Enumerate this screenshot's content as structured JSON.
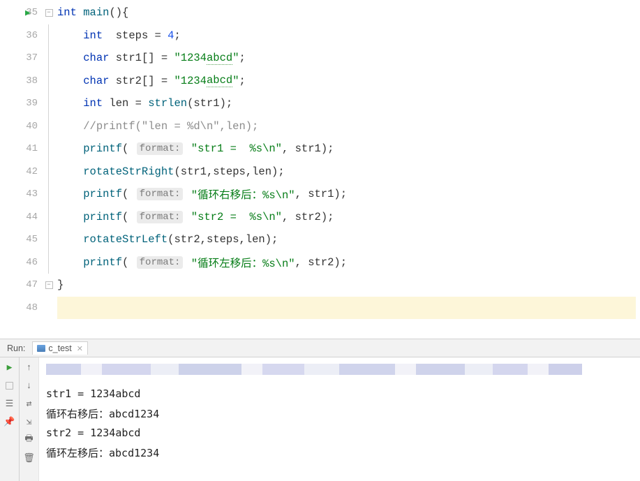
{
  "gutter": {
    "lines": [
      "35",
      "36",
      "37",
      "38",
      "39",
      "40",
      "41",
      "42",
      "43",
      "44",
      "45",
      "46",
      "47",
      "48"
    ]
  },
  "code": {
    "l35": {
      "kw1": "int ",
      "fn": "main",
      "paren": "(){"
    },
    "l36": {
      "indent": "    ",
      "kw": "int  ",
      "var": "steps",
      "eq": " = ",
      "num": "4",
      "semi": ";"
    },
    "l37": {
      "indent": "    ",
      "kw": "char ",
      "var": "str1",
      "br": "[] = ",
      "str1": "\"1234",
      "str2": "abcd",
      "str3": "\"",
      "semi": ";"
    },
    "l38": {
      "indent": "    ",
      "kw": "char ",
      "var": "str2",
      "br": "[] = ",
      "str1": "\"1234",
      "str2": "abcd",
      "str3": "\"",
      "semi": ";"
    },
    "l39": {
      "indent": "    ",
      "kw": "int ",
      "var": "len",
      "eq": " = ",
      "fn": "strlen",
      "p1": "(",
      "arg": "str1",
      "p2": ");"
    },
    "l40": {
      "indent": "    ",
      "cm": "//printf(\"len = %d\\n\",len);"
    },
    "l41": {
      "indent": "    ",
      "fn": "printf",
      "p1": "( ",
      "hint": "format:",
      "sp": " ",
      "str": "\"str1 =  %s\\n\"",
      "comma": ", ",
      "arg": "str1",
      "p2": ");"
    },
    "l42": {
      "indent": "    ",
      "fn": "rotateStrRight",
      "p1": "(",
      "a1": "str1",
      "c1": ",",
      "a2": "steps",
      "c2": ",",
      "a3": "len",
      "p2": ");"
    },
    "l43": {
      "indent": "    ",
      "fn": "printf",
      "p1": "( ",
      "hint": "format:",
      "sp": " ",
      "str": "\"循环右移后：%s\\n\"",
      "comma": ", ",
      "arg": "str1",
      "p2": ");"
    },
    "l44": {
      "indent": "    ",
      "fn": "printf",
      "p1": "( ",
      "hint": "format:",
      "sp": " ",
      "str": "\"str2 =  %s\\n\"",
      "comma": ", ",
      "arg": "str2",
      "p2": ");"
    },
    "l45": {
      "indent": "    ",
      "fn": "rotateStrLeft",
      "p1": "(",
      "a1": "str2",
      "c1": ",",
      "a2": "steps",
      "c2": ",",
      "a3": "len",
      "p2": ");"
    },
    "l46": {
      "indent": "    ",
      "fn": "printf",
      "p1": "( ",
      "hint": "format:",
      "sp": " ",
      "str": "\"循环左移后：%s\\n\"",
      "comma": ", ",
      "arg": "str2",
      "p2": ");"
    },
    "l47": {
      "close": "}"
    }
  },
  "run": {
    "label": "Run:",
    "tab": "c_test",
    "out1": "str1 =  1234abcd",
    "out2": "循环右移后：abcd1234",
    "out3": "str2 =  1234abcd",
    "out4": "循环左移后：abcd1234"
  }
}
